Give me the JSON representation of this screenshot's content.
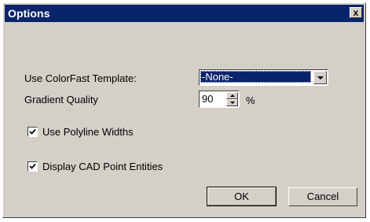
{
  "dialog": {
    "title": "Options",
    "close_label": "x"
  },
  "template": {
    "label": "Use ColorFast Template:",
    "selected": "-None-"
  },
  "gradient": {
    "label": "Gradient Quality",
    "value": "90",
    "unit": "%"
  },
  "options": {
    "polyline": {
      "label": "Use Polyline Widths",
      "checked": true
    },
    "cad_points": {
      "label": "Display CAD Point Entities",
      "checked": true
    }
  },
  "buttons": {
    "ok": "OK",
    "cancel": "Cancel"
  },
  "colors": {
    "titlebar": "#0a246a",
    "face": "#d4d0c8",
    "selection": "#0a246a"
  }
}
